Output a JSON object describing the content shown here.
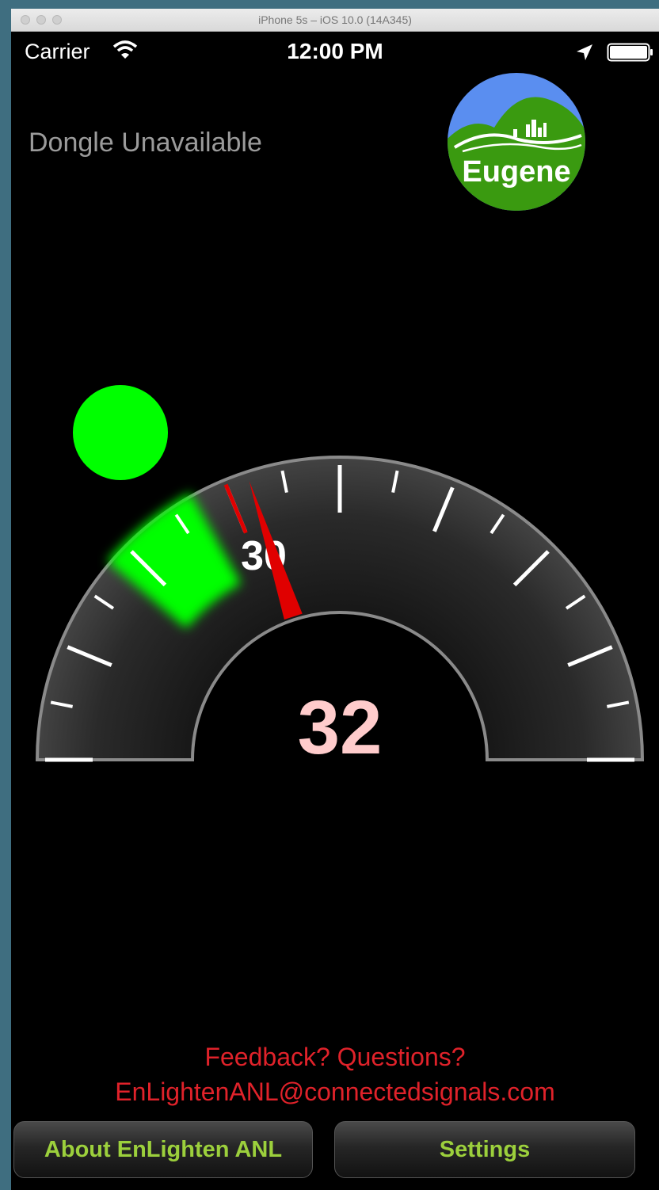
{
  "window": {
    "title": "iPhone 5s – iOS 10.0 (14A345)"
  },
  "status_bar": {
    "carrier": "Carrier",
    "time": "12:00 PM"
  },
  "status": {
    "dongle_text": "Dongle Unavailable"
  },
  "logo": {
    "text": "Eugene",
    "sky_color": "#5a8ef0",
    "hill_color": "#3a9a10"
  },
  "speedometer": {
    "limit_label": "30",
    "current_speed": "32",
    "needle_value": 32,
    "green_band_start": 18,
    "green_band_end": 27,
    "signal_light_color": "#00ff00",
    "needle_color": "#e00000",
    "speed_color": "#ffcccc"
  },
  "feedback": {
    "line1": "Feedback? Questions?",
    "line2": "EnLightenANL@connectedsignals.com"
  },
  "buttons": {
    "about": "About EnLighten ANL",
    "settings": "Settings"
  }
}
